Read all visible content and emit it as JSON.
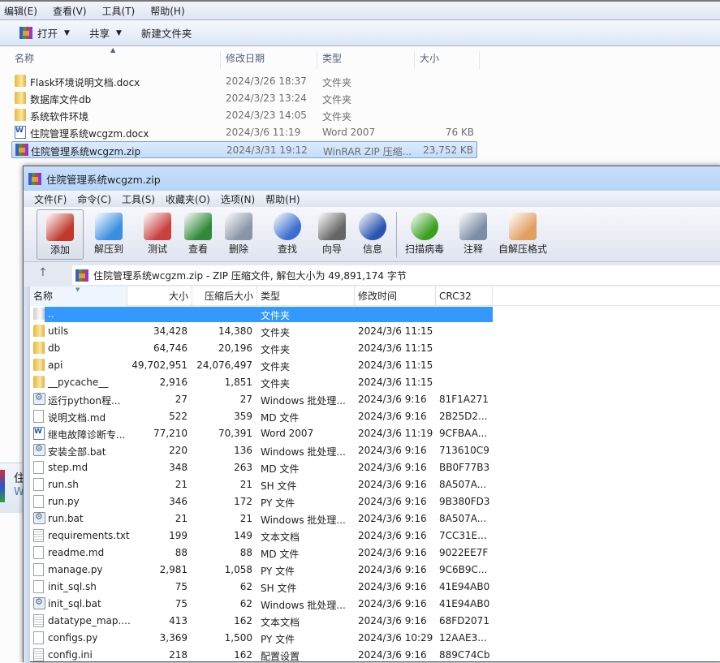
{
  "explorer": {
    "menu": [
      "编辑(E)",
      "查看(V)",
      "工具(T)",
      "帮助(H)"
    ],
    "toolbar": {
      "open": "打开",
      "share": "共享",
      "new_folder": "新建文件夹"
    },
    "columns": {
      "name": "名称",
      "date": "修改日期",
      "type": "类型",
      "size": "大小"
    },
    "files": [
      {
        "icon": "folder",
        "name": "Flask环境说明文档.docx",
        "date": "2024/3/26 18:37",
        "type": "文件夹",
        "size": ""
      },
      {
        "icon": "folder",
        "name": "数据库文件db",
        "date": "2024/3/23 13:24",
        "type": "文件夹",
        "size": ""
      },
      {
        "icon": "folder",
        "name": "系统软件环境",
        "date": "2024/3/23 14:05",
        "type": "文件夹",
        "size": ""
      },
      {
        "icon": "word",
        "name": "住院管理系统wcgzm.docx",
        "date": "2024/3/6 11:19",
        "type": "Word 2007",
        "size": "76 KB"
      },
      {
        "icon": "rar",
        "name": "住院管理系统wcgzm.zip",
        "date": "2024/3/31 19:12",
        "type": "WinRAR ZIP 压缩...",
        "size": "23,752 KB",
        "selected": true
      }
    ],
    "details": {
      "name": "住",
      "type": "W"
    }
  },
  "winrar": {
    "title": "住院管理系统wcgzm.zip",
    "menu": [
      "文件(F)",
      "命令(C)",
      "工具(S)",
      "收藏夹(O)",
      "选项(N)",
      "帮助(H)"
    ],
    "toolbar": [
      {
        "label": "添加",
        "icon": "add-archive-icon",
        "color": "#c0392b"
      },
      {
        "label": "解压到",
        "icon": "extract-folder-icon",
        "color": "#3b8fe0"
      },
      {
        "label": "测试",
        "icon": "test-clipboard-icon",
        "color": "#c94040"
      },
      {
        "label": "查看",
        "icon": "view-book-icon",
        "color": "#2f8a3a"
      },
      {
        "label": "删除",
        "icon": "trash-icon",
        "color": "#8a96a6"
      },
      {
        "label": "查找",
        "icon": "find-magnifier-icon",
        "color": "#3b6fd0"
      },
      {
        "label": "向导",
        "icon": "wizard-wand-icon",
        "color": "#666666"
      },
      {
        "label": "信息",
        "icon": "info-icon",
        "color": "#2a55b0"
      },
      {
        "label": "扫描病毒",
        "icon": "virus-scan-icon",
        "color": "#3aa020"
      },
      {
        "label": "注释",
        "icon": "comment-icon",
        "color": "#7c8ea6"
      },
      {
        "label": "自解压格式",
        "icon": "sfx-box-icon",
        "color": "#e0a060"
      }
    ],
    "address": "住院管理系统wcgzm.zip - ZIP 压缩文件, 解包大小为 49,891,174 字节",
    "columns": {
      "name": "名称",
      "size": "大小",
      "packed": "压缩后大小",
      "type": "类型",
      "modified": "修改时间",
      "crc": "CRC32"
    },
    "files": [
      {
        "icon": "up",
        "name": "..",
        "size": "",
        "packed": "",
        "type": "文件夹",
        "modified": "",
        "crc": "",
        "selected": true
      },
      {
        "icon": "folder",
        "name": "utils",
        "size": "34,428",
        "packed": "14,380",
        "type": "文件夹",
        "modified": "2024/3/6 11:15",
        "crc": ""
      },
      {
        "icon": "folder",
        "name": "db",
        "size": "64,746",
        "packed": "20,196",
        "type": "文件夹",
        "modified": "2024/3/6 11:15",
        "crc": ""
      },
      {
        "icon": "folder",
        "name": "api",
        "size": "49,702,951",
        "packed": "24,076,497",
        "type": "文件夹",
        "modified": "2024/3/6 11:15",
        "crc": ""
      },
      {
        "icon": "folder",
        "name": "__pycache__",
        "size": "2,916",
        "packed": "1,851",
        "type": "文件夹",
        "modified": "2024/3/6 11:15",
        "crc": ""
      },
      {
        "icon": "bat",
        "name": "运行python程...",
        "size": "27",
        "packed": "27",
        "type": "Windows 批处理...",
        "modified": "2024/3/6 9:16",
        "crc": "81F1A271"
      },
      {
        "icon": "doc",
        "name": "说明文档.md",
        "size": "522",
        "packed": "359",
        "type": "MD 文件",
        "modified": "2024/3/6 9:16",
        "crc": "2B25D2..."
      },
      {
        "icon": "word",
        "name": "继电故障诊断专...",
        "size": "77,210",
        "packed": "70,391",
        "type": "Word 2007",
        "modified": "2024/3/6 11:19",
        "crc": "9CFBAA..."
      },
      {
        "icon": "bat",
        "name": "安装全部.bat",
        "size": "220",
        "packed": "136",
        "type": "Windows 批处理...",
        "modified": "2024/3/6 9:16",
        "crc": "713610C9"
      },
      {
        "icon": "doc",
        "name": "step.md",
        "size": "348",
        "packed": "263",
        "type": "MD 文件",
        "modified": "2024/3/6 9:16",
        "crc": "BB0F77B3"
      },
      {
        "icon": "doc",
        "name": "run.sh",
        "size": "21",
        "packed": "21",
        "type": "SH 文件",
        "modified": "2024/3/6 9:16",
        "crc": "8A507A..."
      },
      {
        "icon": "doc",
        "name": "run.py",
        "size": "346",
        "packed": "172",
        "type": "PY 文件",
        "modified": "2024/3/6 9:16",
        "crc": "9B380FD3"
      },
      {
        "icon": "bat",
        "name": "run.bat",
        "size": "21",
        "packed": "21",
        "type": "Windows 批处理...",
        "modified": "2024/3/6 9:16",
        "crc": "8A507A..."
      },
      {
        "icon": "txt",
        "name": "requirements.txt",
        "size": "199",
        "packed": "149",
        "type": "文本文档",
        "modified": "2024/3/6 9:16",
        "crc": "7CC31E..."
      },
      {
        "icon": "doc",
        "name": "readme.md",
        "size": "88",
        "packed": "88",
        "type": "MD 文件",
        "modified": "2024/3/6 9:16",
        "crc": "9022EE7F"
      },
      {
        "icon": "doc",
        "name": "manage.py",
        "size": "2,981",
        "packed": "1,058",
        "type": "PY 文件",
        "modified": "2024/3/6 9:16",
        "crc": "9C6B9C..."
      },
      {
        "icon": "doc",
        "name": "init_sql.sh",
        "size": "75",
        "packed": "62",
        "type": "SH 文件",
        "modified": "2024/3/6 9:16",
        "crc": "41E94AB0"
      },
      {
        "icon": "bat",
        "name": "init_sql.bat",
        "size": "75",
        "packed": "62",
        "type": "Windows 批处理...",
        "modified": "2024/3/6 9:16",
        "crc": "41E94AB0"
      },
      {
        "icon": "txt",
        "name": "datatype_map....",
        "size": "413",
        "packed": "162",
        "type": "文本文档",
        "modified": "2024/3/6 9:16",
        "crc": "68FD2071"
      },
      {
        "icon": "doc",
        "name": "configs.py",
        "size": "3,369",
        "packed": "1,500",
        "type": "PY 文件",
        "modified": "2024/3/6 10:29",
        "crc": "12AAE3..."
      },
      {
        "icon": "txt",
        "name": "config.ini",
        "size": "218",
        "packed": "162",
        "type": "配置设置",
        "modified": "2024/3/6 9:16",
        "crc": "889C74Cb"
      }
    ]
  }
}
